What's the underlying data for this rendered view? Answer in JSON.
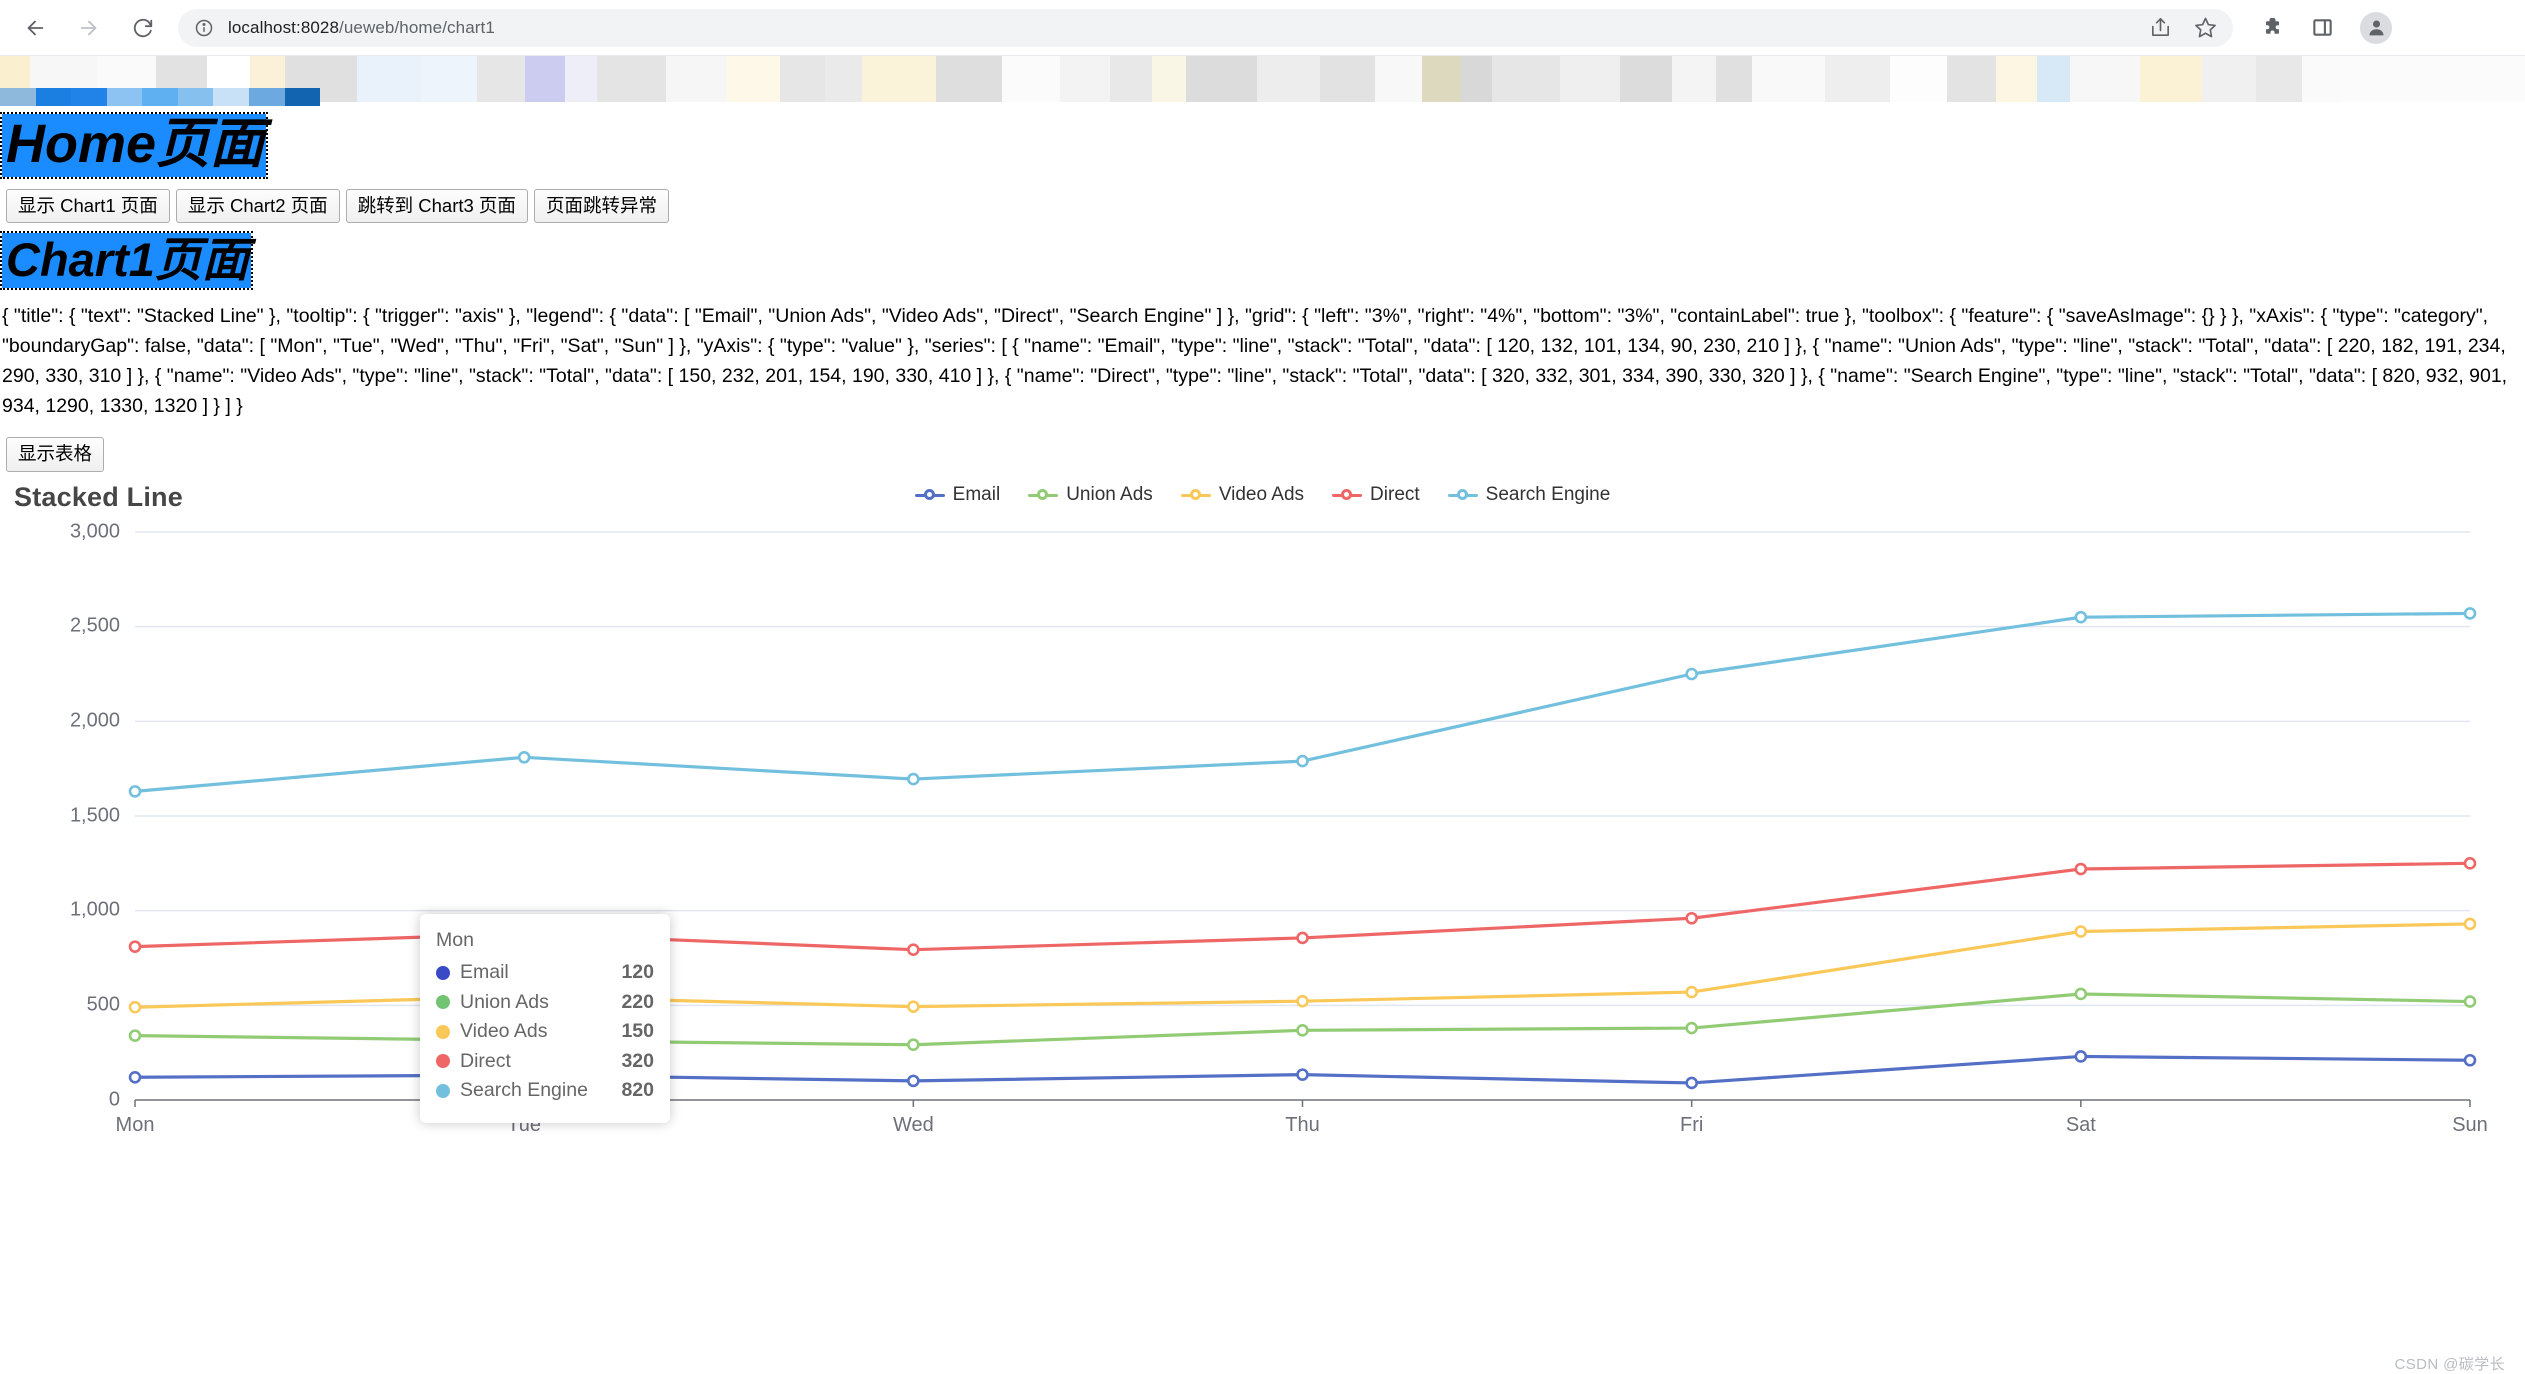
{
  "browser": {
    "url_host": "localhost:8028",
    "url_path": "/ueweb/home/chart1",
    "back_icon": "back-arrow-icon",
    "forward_icon": "forward-arrow-icon",
    "reload_icon": "reload-icon",
    "info_icon": "site-info-icon",
    "share_icon": "share-icon",
    "bookmark_icon": "star-icon",
    "extensions_icon": "puzzle-icon",
    "sidepanel_icon": "side-panel-icon",
    "profile_icon": "profile-avatar-icon"
  },
  "page": {
    "home_heading": "Home页面",
    "chart_heading": "Chart1页面",
    "nav_buttons": [
      {
        "label": "显示 Chart1 页面"
      },
      {
        "label": "显示 Chart2 页面"
      },
      {
        "label": "跳转到 Chart3 页面"
      },
      {
        "label": "页面跳转异常"
      }
    ],
    "show_table_button": "显示表格",
    "config_json": "{ \"title\": { \"text\": \"Stacked Line\" }, \"tooltip\": { \"trigger\": \"axis\" }, \"legend\": { \"data\": [ \"Email\", \"Union Ads\", \"Video Ads\", \"Direct\", \"Search Engine\" ] }, \"grid\": { \"left\": \"3%\", \"right\": \"4%\", \"bottom\": \"3%\", \"containLabel\": true }, \"toolbox\": { \"feature\": { \"saveAsImage\": {} } }, \"xAxis\": { \"type\": \"category\", \"boundaryGap\": false, \"data\": [ \"Mon\", \"Tue\", \"Wed\", \"Thu\", \"Fri\", \"Sat\", \"Sun\" ] }, \"yAxis\": { \"type\": \"value\" }, \"series\": [ { \"name\": \"Email\", \"type\": \"line\", \"stack\": \"Total\", \"data\": [ 120, 132, 101, 134, 90, 230, 210 ] }, { \"name\": \"Union Ads\", \"type\": \"line\", \"stack\": \"Total\", \"data\": [ 220, 182, 191, 234, 290, 330, 310 ] }, { \"name\": \"Video Ads\", \"type\": \"line\", \"stack\": \"Total\", \"data\": [ 150, 232, 201, 154, 190, 330, 410 ] }, { \"name\": \"Direct\", \"type\": \"line\", \"stack\": \"Total\", \"data\": [ 320, 332, 301, 334, 390, 330, 320 ] }, { \"name\": \"Search Engine\", \"type\": \"line\", \"stack\": \"Total\", \"data\": [ 820, 932, 901, 934, 1290, 1330, 1320 ] } ] }",
    "watermark": "CSDN @碳学长"
  },
  "tooltip": {
    "title": "Mon",
    "rows": [
      {
        "name": "Email",
        "value": "120",
        "color": "#3a49c6"
      },
      {
        "name": "Union Ads",
        "value": "220",
        "color": "#72c472"
      },
      {
        "name": "Video Ads",
        "value": "150",
        "color": "#fac858"
      },
      {
        "name": "Direct",
        "value": "320",
        "color": "#ee6666"
      },
      {
        "name": "Search Engine",
        "value": "820",
        "color": "#73c0de"
      }
    ]
  },
  "chart_data": {
    "type": "line",
    "stacked": true,
    "title": "Stacked Line",
    "xlabel": "",
    "ylabel": "",
    "grid": true,
    "legend_position": "top-center",
    "categories": [
      "Mon",
      "Tue",
      "Wed",
      "Thu",
      "Fri",
      "Sat",
      "Sun"
    ],
    "ylim": [
      0,
      3000
    ],
    "yticks": [
      "0",
      "500",
      "1,000",
      "1,500",
      "2,000",
      "2,500",
      "3,000"
    ],
    "series": [
      {
        "name": "Email",
        "color": "#5470c6",
        "values": [
          120,
          132,
          101,
          134,
          90,
          230,
          210
        ]
      },
      {
        "name": "Union Ads",
        "color": "#91cc75",
        "values": [
          220,
          182,
          191,
          234,
          290,
          330,
          310
        ]
      },
      {
        "name": "Video Ads",
        "color": "#fac858",
        "values": [
          150,
          232,
          201,
          154,
          190,
          330,
          410
        ]
      },
      {
        "name": "Direct",
        "color": "#ee6666",
        "values": [
          320,
          332,
          301,
          334,
          390,
          330,
          320
        ]
      },
      {
        "name": "Search Engine",
        "color": "#73c0de",
        "values": [
          820,
          932,
          901,
          934,
          1290,
          1330,
          1320
        ]
      }
    ]
  }
}
